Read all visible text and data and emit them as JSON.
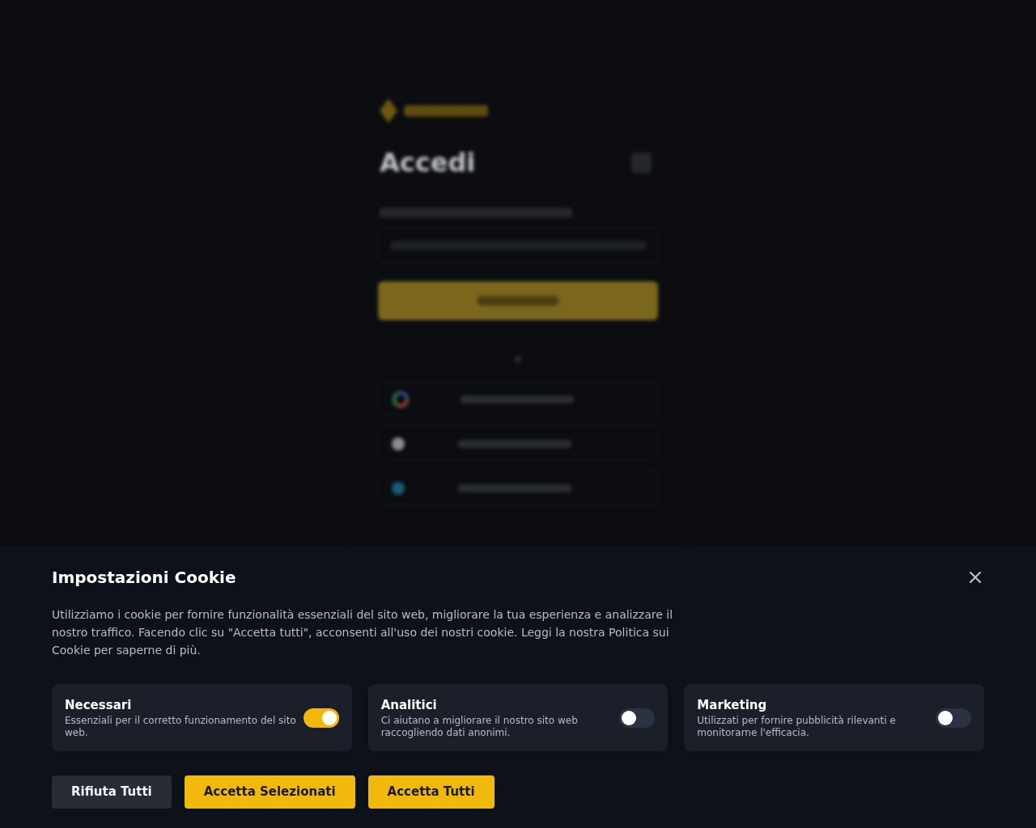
{
  "backdrop": {
    "heading": "Accedi"
  },
  "cookie_panel": {
    "title": "Impostazioni Cookie",
    "description": "Utilizziamo i cookie per fornire funzionalità essenziali del sito web, migliorare la tua esperienza e analizzare il nostro traffico. Facendo clic su \"Accetta tutti\", acconsenti all'uso dei nostri cookie. Leggi la nostra Politica sui Cookie per saperne di più.",
    "categories": [
      {
        "name": "Necessari",
        "description": "Essenziali per il corretto funzionamento del sito web.",
        "on": true
      },
      {
        "name": "Analitici",
        "description": "Ci aiutano a migliorare il nostro sito web raccogliendo dati anonimi.",
        "on": false
      },
      {
        "name": "Marketing",
        "description": "Utilizzati per fornire pubblicità rilevanti e monitorarne l'efficacia.",
        "on": false
      }
    ],
    "buttons": [
      {
        "label": "Rifiuta Tutti",
        "kind": "secondary"
      },
      {
        "label": "Accetta Selezionati",
        "kind": "primary"
      },
      {
        "label": "Accetta Tutti",
        "kind": "primary"
      }
    ]
  }
}
